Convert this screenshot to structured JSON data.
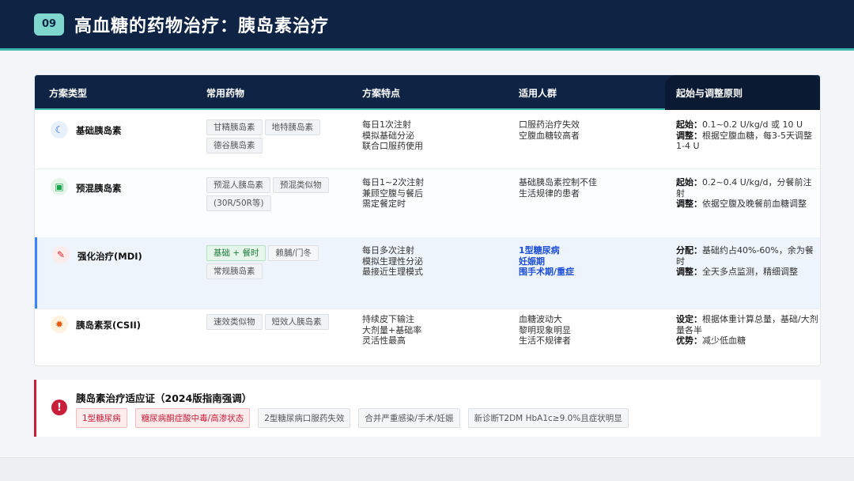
{
  "header": {
    "badge": "09",
    "title": "高血糖的药物治疗：胰岛素治疗"
  },
  "table": {
    "columns": [
      "方案类型",
      "常用药物",
      "方案特点",
      "适用人群",
      "起始与调整原则"
    ],
    "rows": [
      {
        "icon": "moon-icon",
        "name": "基础胰岛素",
        "drugs": [
          "甘精胰岛素",
          "地特胰岛素",
          "德谷胰岛素"
        ],
        "features": [
          "每日1次注射",
          "模拟基础分泌",
          "联合口服药使用"
        ],
        "population": [
          "口服药治疗失效",
          "空腹血糖较高者"
        ],
        "rule_parts": [
          {
            "k": "起始：",
            "v": "0.1~0.2 U/kg/d 或 10 U"
          },
          {
            "k": "调整：",
            "v": "根据空腹血糖，每3-5天调整1-4 U"
          }
        ]
      },
      {
        "icon": "vial-icon",
        "name": "预混胰岛素",
        "drugs": [
          "预混人胰岛素",
          "预混类似物",
          "(30R/50R等)"
        ],
        "features": [
          "每日1~2次注射",
          "兼顾空腹与餐后",
          "需定餐定时"
        ],
        "population": [
          "基础胰岛素控制不佳",
          "生活规律的患者"
        ],
        "rule_parts": [
          {
            "k": "起始：",
            "v": "0.2~0.4 U/kg/d，分餐前注射"
          },
          {
            "k": "调整：",
            "v": "依据空腹及晚餐前血糖调整"
          }
        ]
      },
      {
        "icon": "syringe-icon",
        "name": "强化治疗(MDI)",
        "drugs": [
          "基础 + 餐时",
          "赖脯/门冬",
          "常规胰岛素"
        ],
        "features": [
          "每日多次注射",
          "模拟生理性分泌",
          "最接近生理模式"
        ],
        "population": [
          "1型糖尿病",
          "妊娠期",
          "围手术期/重症"
        ],
        "rule_parts": [
          {
            "k": "分配：",
            "v": "基础约占40%-60%，余为餐时"
          },
          {
            "k": "调整：",
            "v": "全天多点监测，精细调整"
          }
        ]
      },
      {
        "icon": "gear-icon",
        "name": "胰岛素泵(CSII)",
        "drugs": [
          "速效类似物",
          "短效人胰岛素"
        ],
        "features": [
          "持续皮下输注",
          "大剂量+基础率",
          "灵活性最高"
        ],
        "population": [
          "血糖波动大",
          "黎明现象明显",
          "生活不规律者"
        ],
        "rule_parts": [
          {
            "k": "设定：",
            "v": "根据体重计算总量，基础/大剂量各半"
          },
          {
            "k": "优势：",
            "v": "减少低血糖"
          }
        ]
      }
    ]
  },
  "indications": {
    "title": "胰岛素治疗适应证（2024版指南强调）",
    "icon": "alert-icon",
    "tags": [
      "1型糖尿病",
      "糖尿病酮症酸中毒/高渗状态",
      "2型糖尿病口服药失效",
      "合并严重感染/手术/妊娠",
      "新诊断T2DM HbA1c≥9.0%且症状明显"
    ]
  },
  "colors": {
    "navy": "#0f2444",
    "teal": "#3fb8b0",
    "red": "#c81e3a",
    "blue": "#1d4ed8"
  }
}
